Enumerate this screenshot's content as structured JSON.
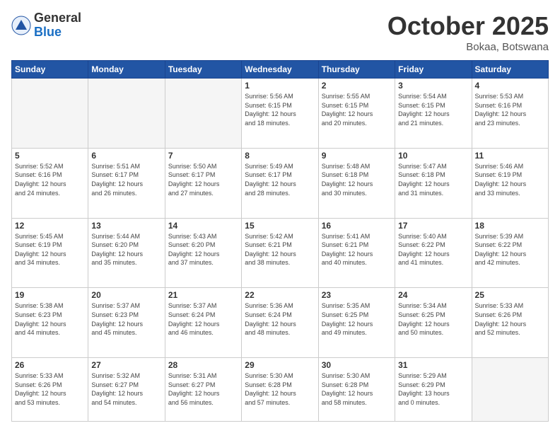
{
  "header": {
    "logo_general": "General",
    "logo_blue": "Blue",
    "month": "October 2025",
    "location": "Bokaa, Botswana"
  },
  "days_of_week": [
    "Sunday",
    "Monday",
    "Tuesday",
    "Wednesday",
    "Thursday",
    "Friday",
    "Saturday"
  ],
  "weeks": [
    [
      {
        "day": "",
        "info": ""
      },
      {
        "day": "",
        "info": ""
      },
      {
        "day": "",
        "info": ""
      },
      {
        "day": "1",
        "info": "Sunrise: 5:56 AM\nSunset: 6:15 PM\nDaylight: 12 hours\nand 18 minutes."
      },
      {
        "day": "2",
        "info": "Sunrise: 5:55 AM\nSunset: 6:15 PM\nDaylight: 12 hours\nand 20 minutes."
      },
      {
        "day": "3",
        "info": "Sunrise: 5:54 AM\nSunset: 6:15 PM\nDaylight: 12 hours\nand 21 minutes."
      },
      {
        "day": "4",
        "info": "Sunrise: 5:53 AM\nSunset: 6:16 PM\nDaylight: 12 hours\nand 23 minutes."
      }
    ],
    [
      {
        "day": "5",
        "info": "Sunrise: 5:52 AM\nSunset: 6:16 PM\nDaylight: 12 hours\nand 24 minutes."
      },
      {
        "day": "6",
        "info": "Sunrise: 5:51 AM\nSunset: 6:17 PM\nDaylight: 12 hours\nand 26 minutes."
      },
      {
        "day": "7",
        "info": "Sunrise: 5:50 AM\nSunset: 6:17 PM\nDaylight: 12 hours\nand 27 minutes."
      },
      {
        "day": "8",
        "info": "Sunrise: 5:49 AM\nSunset: 6:17 PM\nDaylight: 12 hours\nand 28 minutes."
      },
      {
        "day": "9",
        "info": "Sunrise: 5:48 AM\nSunset: 6:18 PM\nDaylight: 12 hours\nand 30 minutes."
      },
      {
        "day": "10",
        "info": "Sunrise: 5:47 AM\nSunset: 6:18 PM\nDaylight: 12 hours\nand 31 minutes."
      },
      {
        "day": "11",
        "info": "Sunrise: 5:46 AM\nSunset: 6:19 PM\nDaylight: 12 hours\nand 33 minutes."
      }
    ],
    [
      {
        "day": "12",
        "info": "Sunrise: 5:45 AM\nSunset: 6:19 PM\nDaylight: 12 hours\nand 34 minutes."
      },
      {
        "day": "13",
        "info": "Sunrise: 5:44 AM\nSunset: 6:20 PM\nDaylight: 12 hours\nand 35 minutes."
      },
      {
        "day": "14",
        "info": "Sunrise: 5:43 AM\nSunset: 6:20 PM\nDaylight: 12 hours\nand 37 minutes."
      },
      {
        "day": "15",
        "info": "Sunrise: 5:42 AM\nSunset: 6:21 PM\nDaylight: 12 hours\nand 38 minutes."
      },
      {
        "day": "16",
        "info": "Sunrise: 5:41 AM\nSunset: 6:21 PM\nDaylight: 12 hours\nand 40 minutes."
      },
      {
        "day": "17",
        "info": "Sunrise: 5:40 AM\nSunset: 6:22 PM\nDaylight: 12 hours\nand 41 minutes."
      },
      {
        "day": "18",
        "info": "Sunrise: 5:39 AM\nSunset: 6:22 PM\nDaylight: 12 hours\nand 42 minutes."
      }
    ],
    [
      {
        "day": "19",
        "info": "Sunrise: 5:38 AM\nSunset: 6:23 PM\nDaylight: 12 hours\nand 44 minutes."
      },
      {
        "day": "20",
        "info": "Sunrise: 5:37 AM\nSunset: 6:23 PM\nDaylight: 12 hours\nand 45 minutes."
      },
      {
        "day": "21",
        "info": "Sunrise: 5:37 AM\nSunset: 6:24 PM\nDaylight: 12 hours\nand 46 minutes."
      },
      {
        "day": "22",
        "info": "Sunrise: 5:36 AM\nSunset: 6:24 PM\nDaylight: 12 hours\nand 48 minutes."
      },
      {
        "day": "23",
        "info": "Sunrise: 5:35 AM\nSunset: 6:25 PM\nDaylight: 12 hours\nand 49 minutes."
      },
      {
        "day": "24",
        "info": "Sunrise: 5:34 AM\nSunset: 6:25 PM\nDaylight: 12 hours\nand 50 minutes."
      },
      {
        "day": "25",
        "info": "Sunrise: 5:33 AM\nSunset: 6:26 PM\nDaylight: 12 hours\nand 52 minutes."
      }
    ],
    [
      {
        "day": "26",
        "info": "Sunrise: 5:33 AM\nSunset: 6:26 PM\nDaylight: 12 hours\nand 53 minutes."
      },
      {
        "day": "27",
        "info": "Sunrise: 5:32 AM\nSunset: 6:27 PM\nDaylight: 12 hours\nand 54 minutes."
      },
      {
        "day": "28",
        "info": "Sunrise: 5:31 AM\nSunset: 6:27 PM\nDaylight: 12 hours\nand 56 minutes."
      },
      {
        "day": "29",
        "info": "Sunrise: 5:30 AM\nSunset: 6:28 PM\nDaylight: 12 hours\nand 57 minutes."
      },
      {
        "day": "30",
        "info": "Sunrise: 5:30 AM\nSunset: 6:28 PM\nDaylight: 12 hours\nand 58 minutes."
      },
      {
        "day": "31",
        "info": "Sunrise: 5:29 AM\nSunset: 6:29 PM\nDaylight: 13 hours\nand 0 minutes."
      },
      {
        "day": "",
        "info": ""
      }
    ]
  ]
}
